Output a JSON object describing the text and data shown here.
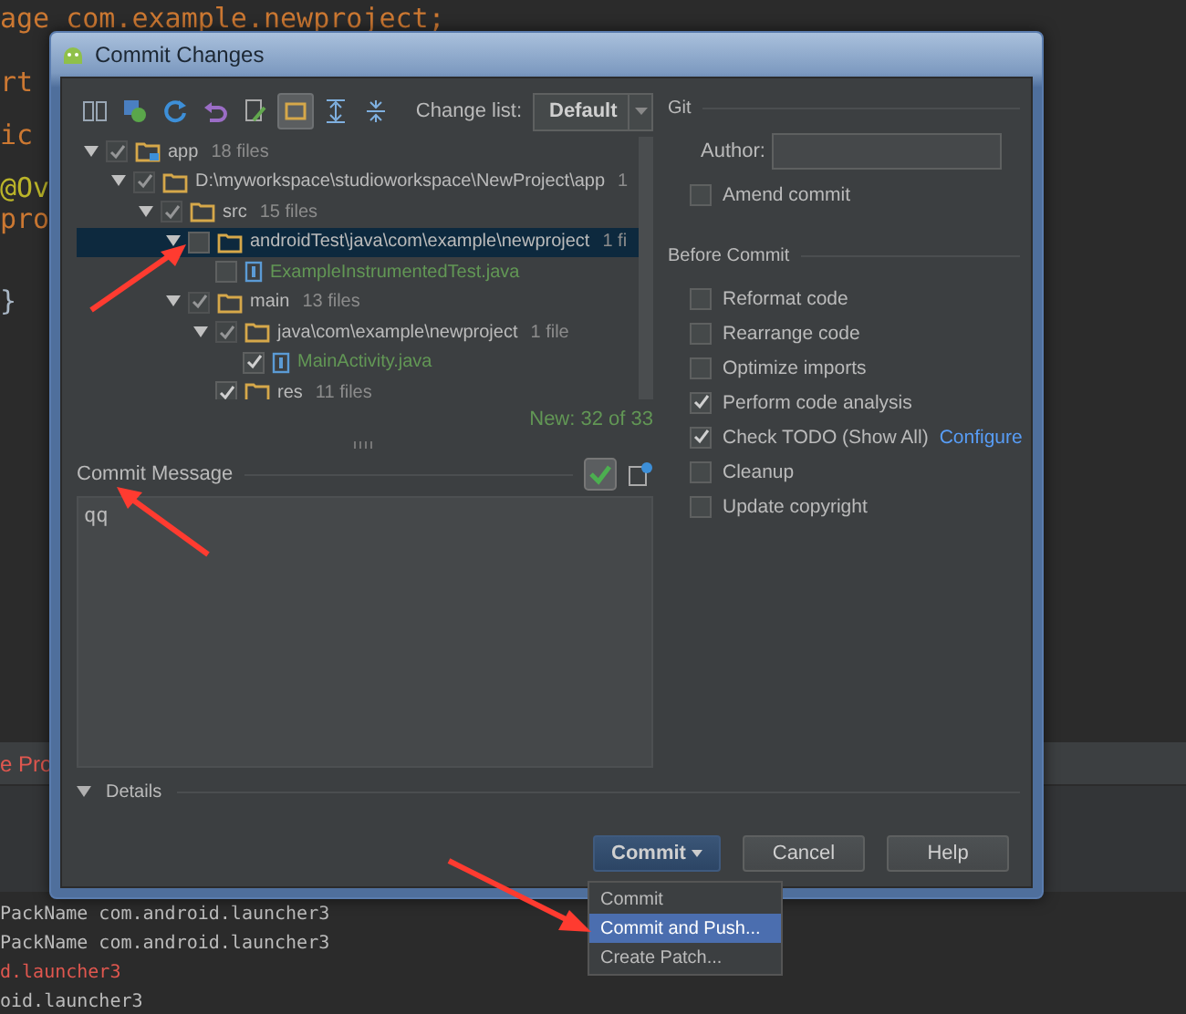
{
  "editor": {
    "lines": [
      {
        "text": "age com.example.newproject;",
        "kind": "package"
      },
      {
        "text": "rt",
        "kind": "keyword"
      },
      {
        "text": "ic",
        "kind": "keyword"
      },
      {
        "text": "@Ov",
        "kind": "annotation"
      },
      {
        "text": "pro",
        "kind": "keyword"
      },
      {
        "text": "}",
        "kind": "plain"
      }
    ]
  },
  "tool_tab": {
    "label": "e Pro"
  },
  "console": {
    "lines": [
      {
        "text": "PackName com.android.launcher3",
        "error": false
      },
      {
        "text": "PackName com.android.launcher3",
        "error": false
      },
      {
        "text": "d.launcher3",
        "error": true
      },
      {
        "text": "oid.launcher3",
        "error": false
      }
    ]
  },
  "dialog": {
    "title": "Commit Changes",
    "toolbar": {
      "icons": [
        {
          "kind": "diff",
          "selected": false
        },
        {
          "kind": "move",
          "selected": false
        },
        {
          "kind": "refresh",
          "selected": false
        },
        {
          "kind": "revert",
          "selected": false
        },
        {
          "kind": "edit",
          "selected": false
        },
        {
          "kind": "group",
          "selected": true
        },
        {
          "kind": "expand",
          "selected": false
        },
        {
          "kind": "collapse",
          "selected": false
        }
      ],
      "changelist_label": "Change list:",
      "changelist_value": "Default"
    },
    "tree": [
      {
        "kind": "module",
        "name": "app",
        "count": "18 files",
        "checked": true,
        "selected": false,
        "new": false,
        "children": [
          {
            "kind": "folder",
            "name": "D:\\myworkspace\\studioworkspace\\NewProject\\app",
            "count": "1",
            "checked": true,
            "selected": false,
            "new": false,
            "children": [
              {
                "kind": "folder",
                "name": "src",
                "count": "15 files",
                "checked": true,
                "selected": false,
                "new": false,
                "children": [
                  {
                    "kind": "folder",
                    "name": "androidTest\\java\\com\\example\\newproject",
                    "count": "1 fi",
                    "checked": false,
                    "selected": true,
                    "new": false,
                    "children": [
                      {
                        "kind": "file",
                        "name": "ExampleInstrumentedTest.java",
                        "checked": false,
                        "selected": false,
                        "new": true
                      }
                    ]
                  },
                  {
                    "kind": "folder",
                    "name": "main",
                    "count": "13 files",
                    "checked": true,
                    "selected": false,
                    "new": false,
                    "children": [
                      {
                        "kind": "folder",
                        "name": "java\\com\\example\\newproject",
                        "count": "1 file",
                        "checked": true,
                        "selected": false,
                        "new": false,
                        "children": [
                          {
                            "kind": "file",
                            "name": "MainActivity.java",
                            "checked": true,
                            "selected": false,
                            "new": true
                          }
                        ]
                      },
                      {
                        "kind": "folder",
                        "name": "res",
                        "count": "11 files",
                        "checked": true,
                        "selected": false,
                        "new": false
                      }
                    ]
                  }
                ]
              }
            ]
          }
        ]
      }
    ],
    "tree_status": "New: 32 of 33",
    "commit_message": {
      "label": "Commit Message",
      "value": "qq"
    },
    "details": {
      "label": "Details",
      "expanded": false
    },
    "git": {
      "label": "Git",
      "author_label": "Author:",
      "options": [
        {
          "label": "Amend commit",
          "checked": false
        }
      ]
    },
    "before_commit": {
      "label": "Before Commit",
      "options": [
        {
          "label": "Reformat code",
          "checked": false
        },
        {
          "label": "Rearrange code",
          "checked": false
        },
        {
          "label": "Optimize imports",
          "checked": false
        },
        {
          "label": "Perform code analysis",
          "checked": true
        },
        {
          "label": "Check TODO (Show All)",
          "checked": true,
          "link": "Configure"
        },
        {
          "label": "Cleanup",
          "checked": false
        },
        {
          "label": "Update copyright",
          "checked": false
        }
      ]
    },
    "buttons": [
      {
        "label": "Commit",
        "kind": "default"
      },
      {
        "label": "Cancel",
        "kind": "normal"
      },
      {
        "label": "Help",
        "kind": "normal"
      }
    ],
    "commit_menu": [
      {
        "label": "Commit",
        "selected": false
      },
      {
        "label": "Commit and Push...",
        "selected": true
      },
      {
        "label": "Create Patch...",
        "selected": false
      }
    ]
  }
}
